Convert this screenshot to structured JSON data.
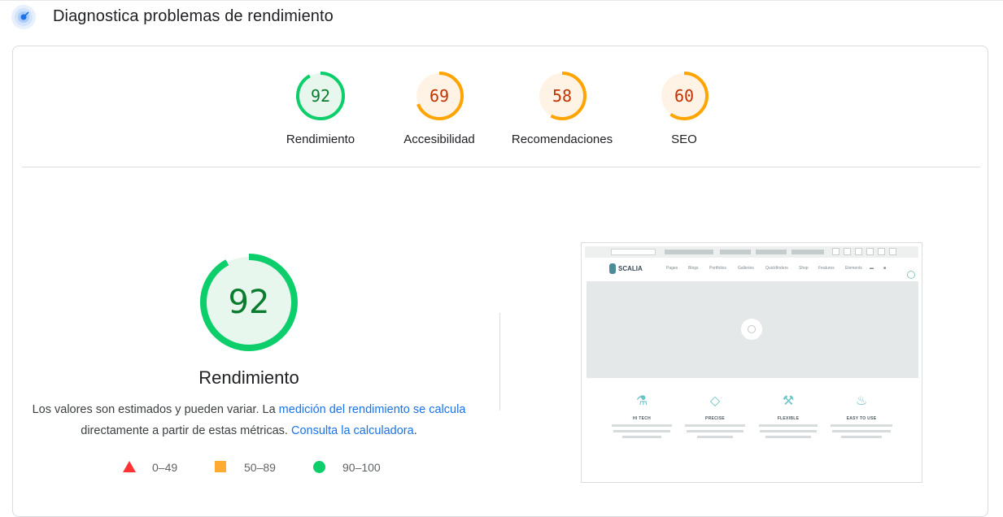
{
  "header": {
    "title": "Diagnostica problemas de rendimiento"
  },
  "colors": {
    "pass": "#0cce6b",
    "average": "#ffa400",
    "fail": "#ff3333",
    "link": "#1a73e8"
  },
  "gauges": [
    {
      "score": "92",
      "label": "Rendimiento",
      "status": "pass"
    },
    {
      "score": "69",
      "label": "Accesibilidad",
      "status": "average"
    },
    {
      "score": "58",
      "label": "Recomendaciones",
      "status": "average"
    },
    {
      "score": "60",
      "label": "SEO",
      "status": "average"
    }
  ],
  "performance": {
    "score": "92",
    "title": "Rendimiento",
    "desc_part1": "Los valores son estimados y pueden variar. La ",
    "desc_link1": "medición del rendimiento se calcula",
    "desc_part2": " directamente a partir de estas métricas. ",
    "desc_link2": "Consulta la calculadora",
    "desc_part3": "."
  },
  "legend": [
    {
      "range": "0–49",
      "shape": "triangle",
      "color": "#ff3333"
    },
    {
      "range": "50–89",
      "shape": "square",
      "color": "#ffaa33"
    },
    {
      "range": "90–100",
      "shape": "circle",
      "color": "#0cce6b"
    }
  ],
  "thumbnail": {
    "logo": "SCALIA",
    "menu": [
      "Pages",
      "Blogs",
      "Portfolios",
      "Galleries",
      "Quickfinders",
      "Shop",
      "Features",
      "Elements"
    ],
    "features": [
      {
        "title": "HI TECH",
        "icon": "flask-icon"
      },
      {
        "title": "PRECISE",
        "icon": "diamond-icon"
      },
      {
        "title": "FLEXIBLE",
        "icon": "tools-icon"
      },
      {
        "title": "EASY TO USE",
        "icon": "dish-icon"
      }
    ]
  }
}
